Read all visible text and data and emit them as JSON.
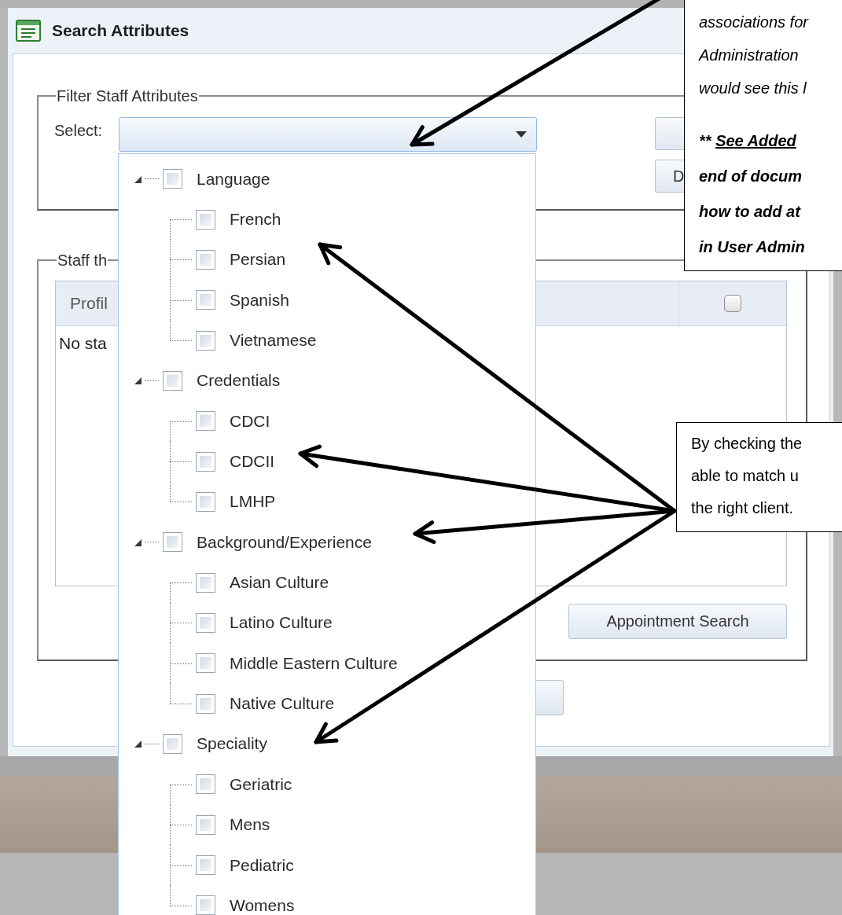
{
  "window": {
    "title": "Search Attributes"
  },
  "filter_group": {
    "title": "Filter Staff Attributes",
    "select_label": "Select:",
    "side_button": "D"
  },
  "staff_group": {
    "title": "Staff th",
    "table": {
      "column_1": "Profil",
      "select_all": {
        "checked": false
      },
      "empty_message": "No sta"
    },
    "button": "Appointment Search"
  },
  "tree": [
    {
      "label": "Language",
      "checked": false,
      "expanded": true,
      "children": [
        {
          "label": "French",
          "checked": false
        },
        {
          "label": "Persian",
          "checked": false
        },
        {
          "label": "Spanish",
          "checked": false
        },
        {
          "label": "Vietnamese",
          "checked": false
        }
      ]
    },
    {
      "label": "Credentials",
      "checked": false,
      "expanded": true,
      "children": [
        {
          "label": "CDCI",
          "checked": false
        },
        {
          "label": "CDCII",
          "checked": false
        },
        {
          "label": "LMHP",
          "checked": false
        }
      ]
    },
    {
      "label": "Background/Experience",
      "checked": false,
      "expanded": true,
      "children": [
        {
          "label": "Asian Culture",
          "checked": false
        },
        {
          "label": "Latino Culture",
          "checked": false
        },
        {
          "label": "Middle Eastern Culture",
          "checked": false
        },
        {
          "label": "Native Culture",
          "checked": false
        }
      ]
    },
    {
      "label": "Speciality",
      "checked": false,
      "expanded": true,
      "children": [
        {
          "label": "Geriatric",
          "checked": false
        },
        {
          "label": "Mens",
          "checked": false
        },
        {
          "label": "Pediatric",
          "checked": false
        },
        {
          "label": "Womens",
          "checked": false
        }
      ]
    }
  ],
  "callouts": [
    {
      "paragraphs": [
        {
          "kind": "note",
          "lines": [
            "associations for",
            "Administration",
            "would see this l"
          ]
        },
        {
          "kind": "emphasis",
          "lines": [
            [
              {
                "text": "** "
              },
              {
                "text": "See Added",
                "underline": true
              }
            ],
            "end of docum",
            "how to add at",
            "in User Admin"
          ]
        }
      ]
    },
    {
      "paragraphs": [
        {
          "kind": "plain",
          "lines": [
            "By checking the",
            "able to match u",
            "the right client."
          ]
        }
      ]
    }
  ]
}
